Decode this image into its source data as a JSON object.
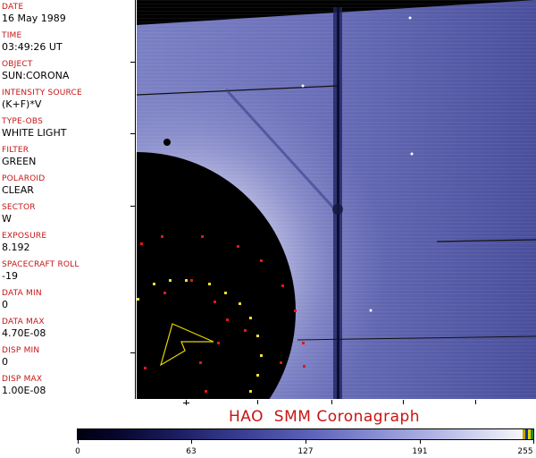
{
  "metadata": {
    "fields": [
      {
        "label": "DATE",
        "value": "16 May 1989"
      },
      {
        "label": "TIME",
        "value": "03:49:26 UT"
      },
      {
        "label": "OBJECT",
        "value": "SUN:CORONA"
      },
      {
        "label": "INTENSITY SOURCE",
        "value": "(K+F)*V"
      },
      {
        "label": "TYPE-OBS",
        "value": "WHITE LIGHT"
      },
      {
        "label": "FILTER",
        "value": "GREEN"
      },
      {
        "label": "POLAROID",
        "value": "CLEAR"
      },
      {
        "label": "SECTOR",
        "value": "W"
      },
      {
        "label": "EXPOSURE",
        "value": "8.192"
      },
      {
        "label": "SPACECRAFT ROLL",
        "value": "-19"
      },
      {
        "label": "DATA MIN",
        "value": "0"
      },
      {
        "label": "DATA MAX",
        "value": "4.70E-08"
      },
      {
        "label": "DISP MIN",
        "value": "0"
      },
      {
        "label": "DISP MAX",
        "value": "1.00E-08"
      }
    ]
  },
  "caption": "HAO  SMM Coronagraph",
  "colorbar": {
    "ticks": [
      "0",
      "63",
      "127",
      "191",
      "255"
    ],
    "colors": {
      "low": "#000010",
      "mid": "#5a5fb8",
      "high": "#ffffff"
    }
  },
  "colors": {
    "label_red": "#c81414",
    "occulter": "#000000",
    "corona": "#8a8fd0"
  }
}
